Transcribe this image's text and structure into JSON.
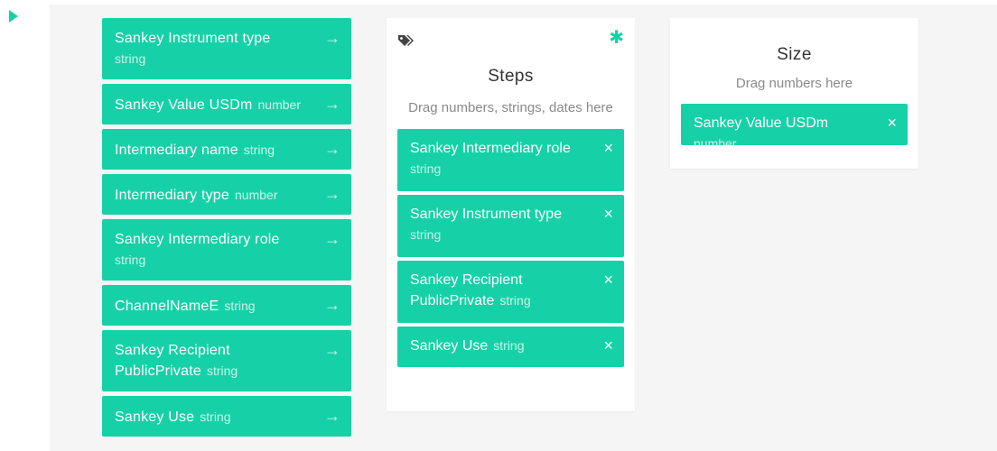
{
  "left_dimensions": [
    {
      "name": "Sankey Instrument type",
      "type": "string"
    },
    {
      "name": "Sankey Value USDm",
      "type": "number"
    },
    {
      "name": "Intermediary name",
      "type": "string"
    },
    {
      "name": "Intermediary type",
      "type": "number"
    },
    {
      "name": "Sankey Intermediary role",
      "type": "string"
    },
    {
      "name": "ChannelNameE",
      "type": "string"
    },
    {
      "name": "Sankey Recipient PublicPrivate",
      "type": "string"
    },
    {
      "name": "Sankey Use",
      "type": "string"
    }
  ],
  "steps_card": {
    "title": "Steps",
    "hint": "Drag numbers, strings, dates here",
    "items": [
      {
        "name": "Sankey Intermediary role",
        "type": "string"
      },
      {
        "name": "Sankey Instrument type",
        "type": "string"
      },
      {
        "name": "Sankey Recipient PublicPrivate",
        "type": "string"
      },
      {
        "name": "Sankey Use",
        "type": "string"
      }
    ]
  },
  "size_card": {
    "title": "Size",
    "hint": "Drag numbers here",
    "items": [
      {
        "name": "Sankey Value USDm",
        "type": "number"
      }
    ]
  },
  "icons": {
    "arrow": "→",
    "remove": "×",
    "required": "✱",
    "tag": "tags-icon",
    "toggle": "play-icon"
  },
  "colors": {
    "accent": "#16d1a7",
    "panel": "#f5f5f5",
    "card": "#ffffff"
  }
}
